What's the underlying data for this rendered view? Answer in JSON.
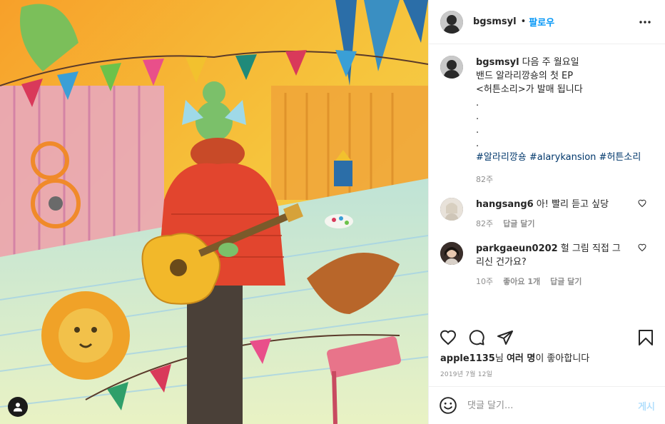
{
  "post": {
    "author": "bgsmsyl",
    "follow_label": "팔로우",
    "dot": "•",
    "icons": {
      "more": "more-options-icon",
      "tag": "user-tag-icon",
      "like": "heart-icon",
      "comment": "comment-icon",
      "share": "share-icon",
      "save": "bookmark-icon",
      "emoji": "emoji-icon"
    }
  },
  "caption": {
    "username": "bgsmsyl",
    "text": "다음 주 월요일\n밴드 알라리깡숑의 첫 EP\n<허튼소리>가 발매 됩니다\n.\n.\n.\n.",
    "hashtags": [
      "#알라리깡숑",
      "#alarykansion",
      "#허튼소리"
    ],
    "time": "82주"
  },
  "comments": [
    {
      "username": "hangsang6",
      "text": "아! 빨리 듣고 싶당",
      "time": "82주",
      "likes": "",
      "reply": "답글 달기"
    },
    {
      "username": "parkgaeun0202",
      "text": "헐 그림 직접 그\n리신 건가요?",
      "time": "10주",
      "likes": "좋아요 1개",
      "reply": "답글 달기"
    }
  ],
  "likes": {
    "user": "apple1135",
    "suffix1": "님 ",
    "others": "여러 명",
    "suffix2": "이 좋아합니다"
  },
  "date": "2019년 7월 12일",
  "add_comment": {
    "placeholder": "댓글 달기...",
    "post_label": "게시"
  },
  "colors": {
    "accent": "#0095f6",
    "hashtag": "#00376b",
    "muted": "#8e8e8e",
    "disabled_post": "#b2dffc"
  }
}
